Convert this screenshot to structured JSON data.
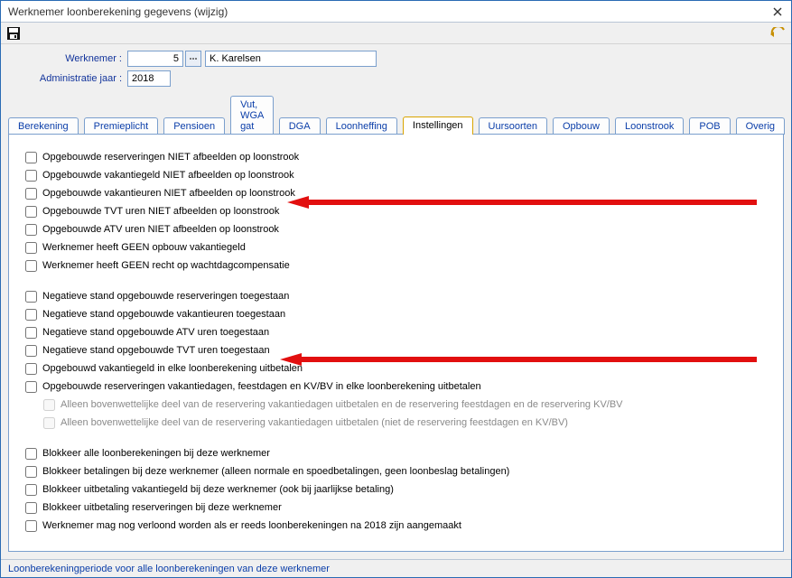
{
  "window": {
    "title": "Werknemer loonberekening gegevens  (wijzig)"
  },
  "header": {
    "werknemer_label": "Werknemer :",
    "werknemer_num": "5",
    "werknemer_name": "K. Karelsen",
    "admin_jaar_label": "Administratie jaar :",
    "admin_jaar": "2018"
  },
  "tabs": [
    {
      "label": "Berekening"
    },
    {
      "label": "Premieplicht"
    },
    {
      "label": "Pensioen"
    },
    {
      "label": "Vut, WGA gat"
    },
    {
      "label": "DGA"
    },
    {
      "label": "Loonheffing"
    },
    {
      "label": "Instellingen",
      "active": true
    },
    {
      "label": "Uursoorten"
    },
    {
      "label": "Opbouw"
    },
    {
      "label": "Loonstrook"
    },
    {
      "label": "POB"
    },
    {
      "label": "Overig"
    }
  ],
  "checkgroups": [
    [
      {
        "label": "Opgebouwde reserveringen NIET afbeelden op loonstrook"
      },
      {
        "label": "Opgebouwde vakantiegeld NIET afbeelden op loonstrook"
      },
      {
        "label": "Opgebouwde vakantieuren NIET afbeelden op loonstrook"
      },
      {
        "label": "Opgebouwde TVT uren NIET afbeelden op loonstrook"
      },
      {
        "label": "Opgebouwde ATV uren NIET afbeelden op loonstrook"
      },
      {
        "label": "Werknemer heeft GEEN opbouw vakantiegeld"
      },
      {
        "label": "Werknemer heeft GEEN recht op wachtdagcompensatie"
      }
    ],
    [
      {
        "label": "Negatieve stand opgebouwde reserveringen toegestaan"
      },
      {
        "label": "Negatieve stand opgebouwde vakantieuren toegestaan"
      },
      {
        "label": "Negatieve stand opgebouwde ATV uren toegestaan"
      },
      {
        "label": "Negatieve stand opgebouwde TVT uren toegestaan"
      },
      {
        "label": "Opgebouwd vakantiegeld in elke loonberekening uitbetalen"
      },
      {
        "label": "Opgebouwde reserveringen vakantiedagen, feestdagen en KV/BV in elke loonberekening uitbetalen"
      },
      {
        "label": "Alleen bovenwettelijke deel van de reservering vakantiedagen uitbetalen en de reservering feestdagen en de reservering KV/BV",
        "sub": true,
        "disabled": true
      },
      {
        "label": "Alleen bovenwettelijke deel van de reservering vakantiedagen uitbetalen (niet de reservering feestdagen en KV/BV)",
        "sub": true,
        "disabled": true
      }
    ],
    [
      {
        "label": "Blokkeer alle loonberekeningen bij deze werknemer"
      },
      {
        "label": "Blokkeer betalingen bij deze werknemer (alleen normale en spoedbetalingen, geen loonbeslag betalingen)"
      },
      {
        "label": "Blokkeer uitbetaling vakantiegeld bij deze werknemer (ook bij jaarlijkse betaling)"
      },
      {
        "label": "Blokkeer uitbetaling reserveringen bij deze werknemer"
      },
      {
        "label": "Werknemer mag nog verloond worden als er reeds loonberekeningen na 2018 zijn aangemaakt"
      }
    ]
  ],
  "statusbar": {
    "text": "Loonberekeningperiode voor alle loonberekeningen van deze werknemer"
  }
}
